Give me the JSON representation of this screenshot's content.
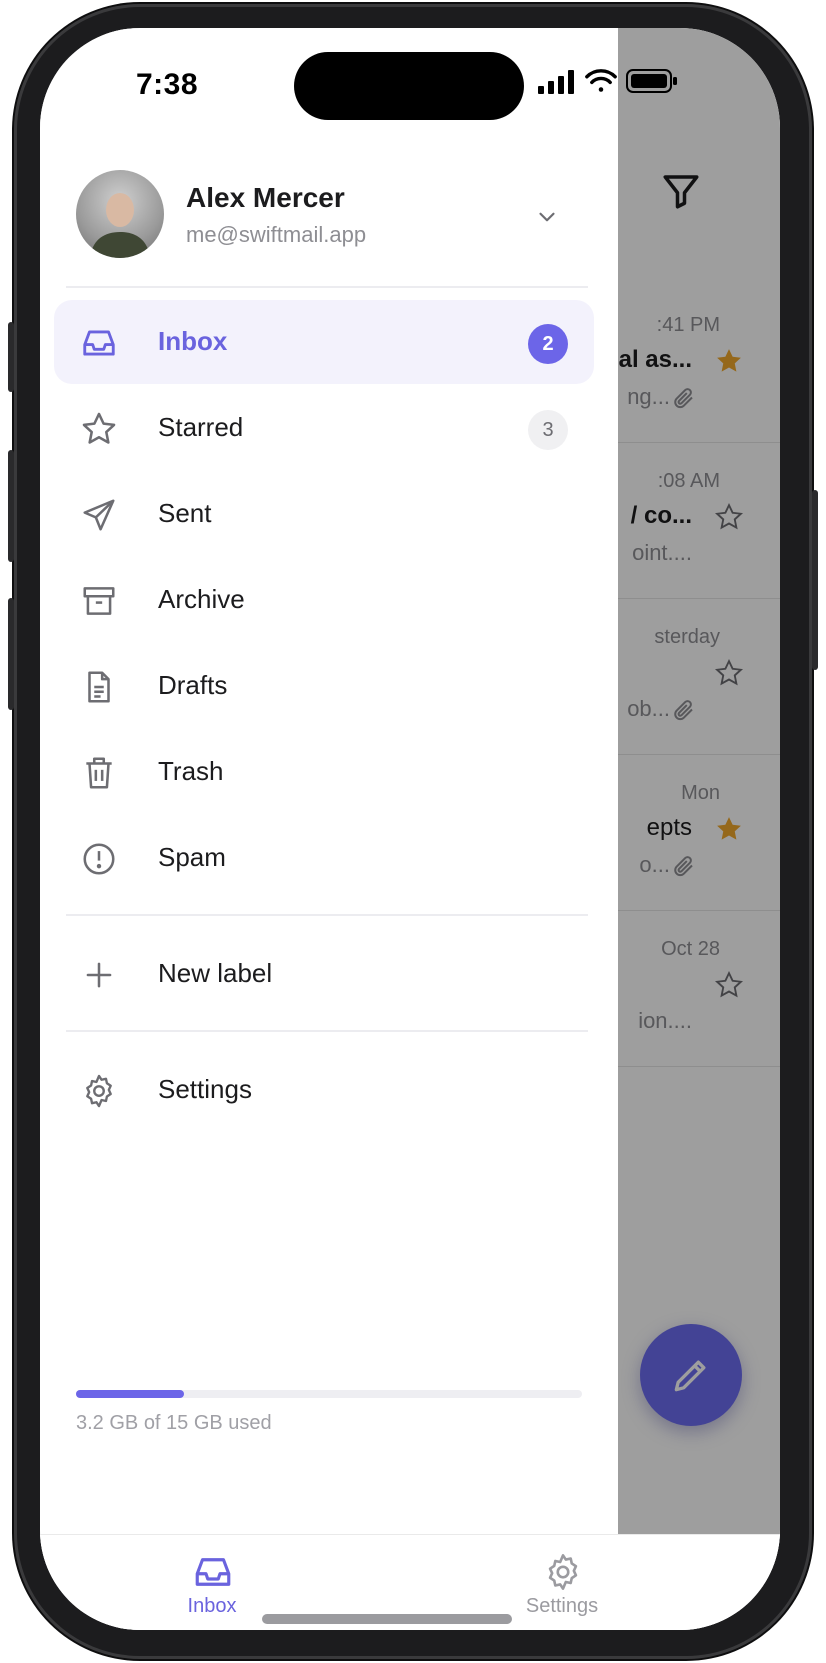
{
  "status_bar": {
    "time": "7:38"
  },
  "account": {
    "name": "Alex Mercer",
    "email": "me@swiftmail.app"
  },
  "nav": {
    "items": [
      {
        "label": "Inbox",
        "badge": "2",
        "icon": "inbox-icon",
        "active": true
      },
      {
        "label": "Starred",
        "badge": "3",
        "icon": "star-icon",
        "active": false
      },
      {
        "label": "Sent",
        "badge": "",
        "icon": "send-icon",
        "active": false
      },
      {
        "label": "Archive",
        "badge": "",
        "icon": "archive-icon",
        "active": false
      },
      {
        "label": "Drafts",
        "badge": "",
        "icon": "document-icon",
        "active": false
      },
      {
        "label": "Trash",
        "badge": "",
        "icon": "trash-icon",
        "active": false
      },
      {
        "label": "Spam",
        "badge": "",
        "icon": "alert-circle-icon",
        "active": false
      }
    ],
    "new_label": "New label",
    "settings": "Settings"
  },
  "storage": {
    "text": "3.2 GB of 15 GB used",
    "used_fraction": 0.213
  },
  "background_list": {
    "rows": [
      {
        "time": ":41 PM",
        "subject": "al as...",
        "preview": "ng...",
        "starred": true,
        "attachment": true
      },
      {
        "time": ":08 AM",
        "subject": "/ co...",
        "preview": "oint....",
        "starred": false,
        "attachment": false
      },
      {
        "time": "sterday",
        "subject": "",
        "preview": "ob...",
        "starred": false,
        "attachment": true
      },
      {
        "time": "Mon",
        "subject": "epts",
        "preview": "o...",
        "starred": true,
        "attachment": true
      },
      {
        "time": "Oct 28",
        "subject": "",
        "preview": "ion....",
        "starred": false,
        "attachment": false
      }
    ]
  },
  "tabbar": {
    "inbox_label": "Inbox",
    "settings_label": "Settings"
  },
  "colors": {
    "accent": "#6c65e8",
    "star": "#f0a92c",
    "active_bg": "#f3f2fc"
  }
}
